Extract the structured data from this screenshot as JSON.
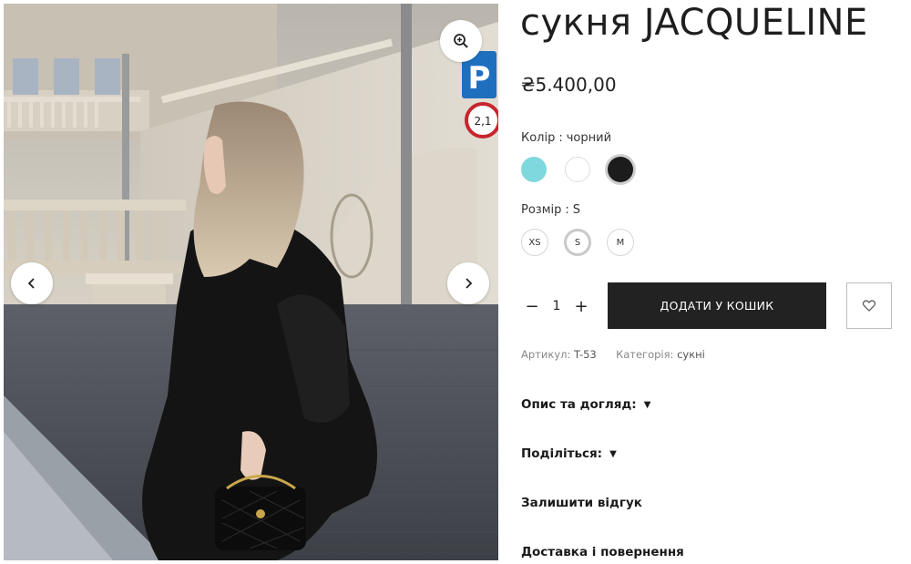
{
  "product": {
    "title": "сукня JACQUELINE",
    "price": "₴5.400,00"
  },
  "options": {
    "color_label": "Колір",
    "color_value": "чорний",
    "colors": [
      {
        "name": "turquoise",
        "hex": "#7fd8de"
      },
      {
        "name": "white",
        "hex": "#ffffff"
      },
      {
        "name": "black",
        "hex": "#1c1c1c",
        "selected": true
      }
    ],
    "size_label": "Розмір",
    "size_value": "S",
    "sizes": [
      "XS",
      "S",
      "M"
    ],
    "selected_size": "S"
  },
  "cart": {
    "quantity": "1",
    "minus": "−",
    "plus": "+",
    "add_label": "ДОДАТИ У КОШИК"
  },
  "meta": {
    "sku_label": "Артикул:",
    "sku_value": "T-53",
    "category_label": "Категорія:",
    "category_value": "сукні"
  },
  "sections": [
    {
      "label": "Опис та догляд:",
      "expandable": true
    },
    {
      "label": "Поділіться:",
      "expandable": true
    },
    {
      "label": "Залишити відгук",
      "expandable": false
    },
    {
      "label": "Доставка і повернення",
      "expandable": false
    }
  ],
  "icons": {
    "zoom": "zoom-in-icon",
    "prev": "chevron-left-icon",
    "next": "chevron-right-icon",
    "wishlist": "heart-icon",
    "caret": "caret-down-icon"
  },
  "colors": {
    "button_dark": "#222222",
    "swatch_turquoise": "#7fd8de"
  }
}
